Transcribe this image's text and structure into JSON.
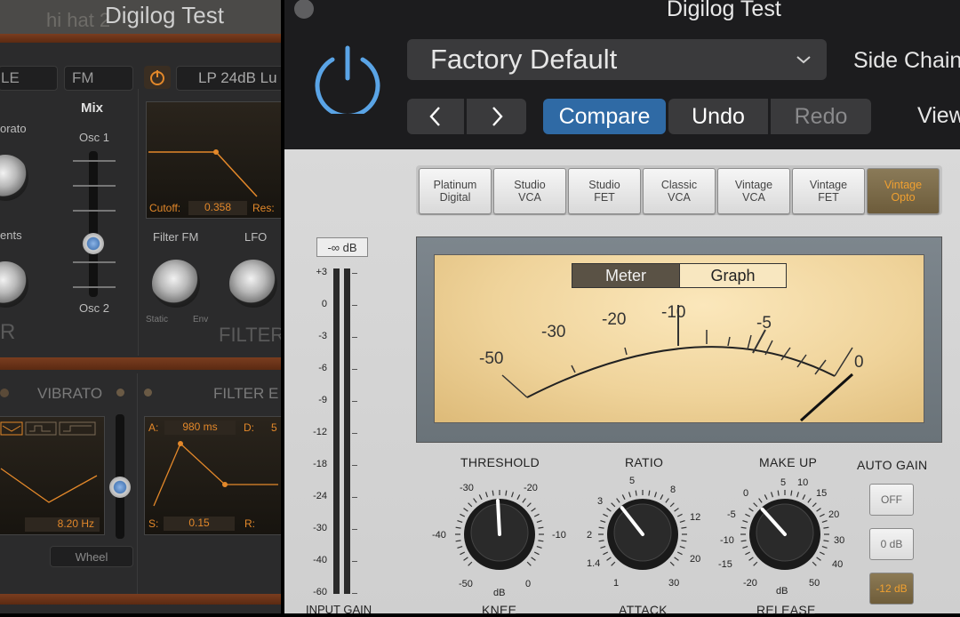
{
  "left_window": {
    "title": "Digilog Test",
    "patch_name": "hi hat 2",
    "tabs": [
      "LE",
      "FM"
    ],
    "mix": {
      "label": "Mix",
      "top": "Osc 1",
      "bottom": "Osc 2"
    },
    "vibrato_label": "orato",
    "ents_label": "ents",
    "filter_mode": "LP 24dB Lu",
    "cutoff_label": "Cutoff:",
    "cutoff_value": "0.358",
    "res_label": "Res:",
    "filter_fm_label": "Filter FM",
    "lfo_label": "LFO",
    "static_label": "Static",
    "env_label": "Env",
    "filter_label": "FILTER",
    "r_label": "R",
    "vibrato_header": "VIBRATO",
    "filter_env_header": "FILTER E",
    "rate_value": "8.20 Hz",
    "a_label": "A:",
    "a_value": "980 ms",
    "d_label": "D:",
    "d_value": "5",
    "s_label": "S:",
    "s_value": "0.15",
    "r2_label": "R:",
    "wheel_label": "Wheel"
  },
  "header": {
    "title": "Digilog Test",
    "preset": "Factory Default",
    "side_chain": "Side Chain",
    "compare": "Compare",
    "undo": "Undo",
    "redo": "Redo",
    "view": "View",
    "accent": "#2f6aa5"
  },
  "models": [
    {
      "l1": "Platinum",
      "l2": "Digital"
    },
    {
      "l1": "Studio",
      "l2": "VCA"
    },
    {
      "l1": "Studio",
      "l2": "FET"
    },
    {
      "l1": "Classic",
      "l2": "VCA"
    },
    {
      "l1": "Vintage",
      "l2": "VCA"
    },
    {
      "l1": "Vintage",
      "l2": "FET"
    },
    {
      "l1": "Vintage",
      "l2": "Opto"
    }
  ],
  "input_meter": {
    "readout": "-∞ dB",
    "scale": [
      "+3",
      "0",
      "-3",
      "-6",
      "-9",
      "-12",
      "-18",
      "-24",
      "-30",
      "-40",
      "-60"
    ],
    "label": "INPUT GAIN"
  },
  "meter": {
    "tab_meter": "Meter",
    "tab_graph": "Graph",
    "scale": [
      "-50",
      "-30",
      "-20",
      "-10",
      "-5",
      "0"
    ]
  },
  "threshold": {
    "label": "THRESHOLD",
    "scale": [
      "-30",
      "-20",
      "-40",
      "-10",
      "-50",
      "0"
    ],
    "unit": "dB"
  },
  "ratio": {
    "label": "RATIO",
    "scale": [
      "5",
      "8",
      "3",
      "12",
      "2",
      "20",
      "1.4",
      "30",
      "1"
    ]
  },
  "makeup": {
    "label": "MAKE UP",
    "scale": [
      "5",
      "10",
      "0",
      "15",
      "-5",
      "20",
      "-10",
      "30",
      "-15",
      "40",
      "-20",
      "50"
    ],
    "unit": "dB"
  },
  "auto_gain": {
    "label": "AUTO GAIN",
    "options": [
      "OFF",
      "0 dB",
      "-12 dB"
    ]
  },
  "bottom_labels": {
    "knee": "KNEE",
    "attack": "ATTACK",
    "release": "RELEASE"
  }
}
